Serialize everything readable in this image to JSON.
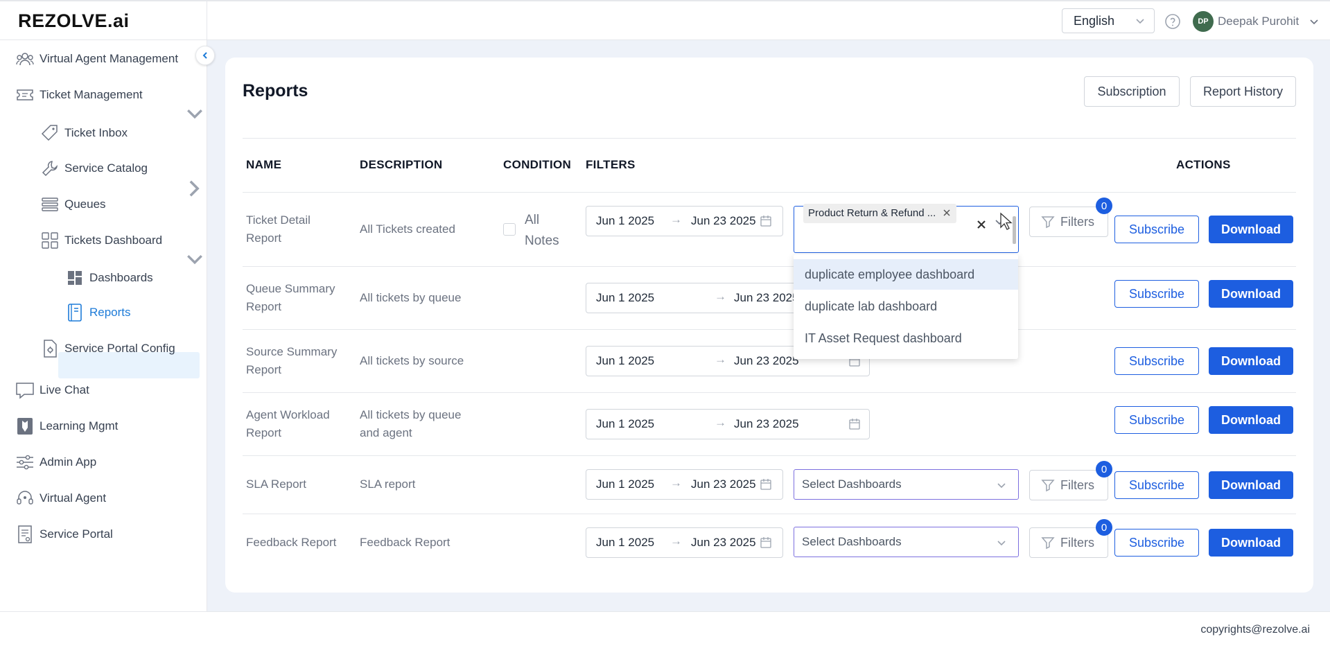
{
  "header": {
    "logo": "REZOLVE.ai",
    "language": "English",
    "user_initials": "DP",
    "user_name": "Deepak Purohit"
  },
  "sidebar": {
    "items": [
      {
        "label": "Virtual Agent Management",
        "icon": "people-icon"
      },
      {
        "label": "Ticket Management",
        "icon": "ticket-icon"
      },
      {
        "label": "Ticket Inbox",
        "icon": "tag-icon"
      },
      {
        "label": "Service Catalog",
        "icon": "wrench-icon"
      },
      {
        "label": "Queues",
        "icon": "list-icon"
      },
      {
        "label": "Tickets Dashboard",
        "icon": "grid-icon"
      },
      {
        "label": "Dashboards",
        "icon": "dashboard-icon"
      },
      {
        "label": "Reports",
        "icon": "report-icon"
      },
      {
        "label": "Service Portal Config",
        "icon": "config-doc-icon"
      },
      {
        "label": "Live Chat",
        "icon": "chat-icon"
      },
      {
        "label": "Learning Mgmt",
        "icon": "learning-icon"
      },
      {
        "label": "Admin App",
        "icon": "sliders-icon"
      },
      {
        "label": "Virtual Agent",
        "icon": "headset-icon"
      },
      {
        "label": "Service Portal",
        "icon": "portal-icon"
      }
    ],
    "active": "Reports"
  },
  "main": {
    "title": "Reports",
    "subscription_label": "Subscription",
    "report_history_label": "Report History",
    "columns": {
      "name": "NAME",
      "description": "DESCRIPTION",
      "condition": "CONDITION",
      "filters": "FILTERS",
      "actions": "ACTIONS"
    },
    "rows": [
      {
        "name_l1": "Ticket Detail",
        "name_l2": "Report",
        "desc_l1": "All Tickets created",
        "desc_l2": "",
        "condition_l1": "All",
        "condition_l2": "Notes",
        "date_from": "Jun 1 2025",
        "date_to": "Jun 23 2025",
        "filter_count": "0"
      },
      {
        "name_l1": "Queue Summary",
        "name_l2": "Report",
        "desc_l1": "All tickets by queue",
        "desc_l2": "",
        "date_from": "Jun 1 2025",
        "date_to": "Jun 23 2025"
      },
      {
        "name_l1": "Source Summary",
        "name_l2": "Report",
        "desc_l1": "All tickets by source",
        "desc_l2": "",
        "date_from": "Jun 1 2025",
        "date_to": "Jun 23 2025"
      },
      {
        "name_l1": "Agent Workload",
        "name_l2": "Report",
        "desc_l1": "All tickets by queue",
        "desc_l2": "and agent",
        "date_from": "Jun 1 2025",
        "date_to": "Jun 23 2025"
      },
      {
        "name_l1": "SLA Report",
        "name_l2": "",
        "desc_l1": "SLA report",
        "desc_l2": "",
        "date_from": "Jun 1 2025",
        "date_to": "Jun 23 2025",
        "select_placeholder": "Select Dashboards",
        "filter_count": "0"
      },
      {
        "name_l1": "Feedback Report",
        "name_l2": "",
        "desc_l1": "Feedback Report",
        "desc_l2": "",
        "date_from": "Jun 1 2025",
        "date_to": "Jun 23 2025",
        "select_placeholder": "Select Dashboards",
        "filter_count": "0"
      }
    ],
    "filters_label": "Filters",
    "subscribe_label": "Subscribe",
    "download_label": "Download",
    "selected_tag": "Product Return & Refund ...",
    "dropdown_options": [
      "duplicate employee dashboard",
      "duplicate lab dashboard",
      "IT Asset Request dashboard"
    ]
  },
  "footer": {
    "copyright": "copyrights@rezolve.ai"
  },
  "colors": {
    "primary": "#1d5ee0",
    "select_border": "#7c6fdf",
    "active_nav": "#e8f3fd"
  }
}
